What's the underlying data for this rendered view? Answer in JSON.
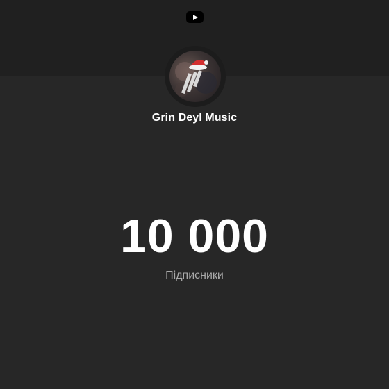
{
  "header": {
    "logo_icon": "youtube-logo-icon"
  },
  "channel": {
    "avatar_icon": "channel-avatar",
    "name": "Grin Deyl Music"
  },
  "stats": {
    "subscriber_count": "10 000",
    "subscriber_label": "Підписники"
  },
  "colors": {
    "background": "#272727",
    "header_band": "#202020",
    "text_primary": "#ffffff",
    "text_secondary": "#a9a9a9",
    "avatar_hat": "#d32f2f"
  }
}
